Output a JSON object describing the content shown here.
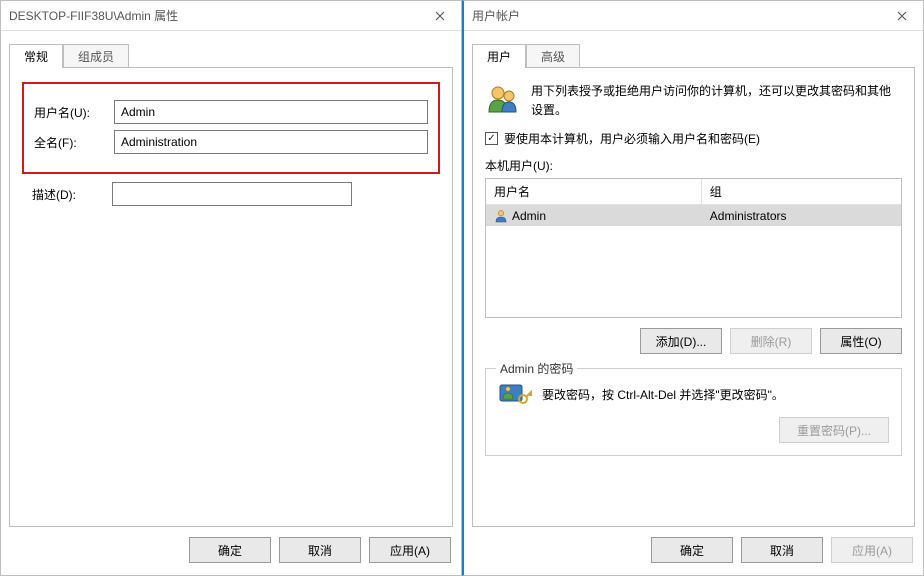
{
  "left": {
    "title": "DESKTOP-FIIF38U\\Admin 属性",
    "tabs": {
      "general": "常规",
      "members": "组成员"
    },
    "labels": {
      "username": "用户名(U):",
      "fullname": "全名(F):",
      "description": "描述(D):"
    },
    "values": {
      "username": "Admin",
      "fullname": "Administration",
      "description": ""
    },
    "buttons": {
      "ok": "确定",
      "cancel": "取消",
      "apply": "应用(A)"
    }
  },
  "right": {
    "title": "用户帐户",
    "tabs": {
      "users": "用户",
      "advanced": "高级"
    },
    "intro": "用下列表授予或拒绝用户访问你的计算机，还可以更改其密码和其他设置。",
    "checkbox_label": "要使用本计算机，用户必须输入用户名和密码(E)",
    "local_users_label": "本机用户(U):",
    "columns": {
      "username": "用户名",
      "group": "组"
    },
    "rows": [
      {
        "username": "Admin",
        "group": "Administrators"
      }
    ],
    "buttons": {
      "add": "添加(D)...",
      "remove": "删除(R)",
      "properties": "属性(O)",
      "ok": "确定",
      "cancel": "取消",
      "apply": "应用(A)",
      "reset_pw": "重置密码(P)..."
    },
    "password_group": {
      "legend": "Admin 的密码",
      "text": "要改密码，按 Ctrl-Alt-Del 并选择\"更改密码\"。"
    }
  }
}
